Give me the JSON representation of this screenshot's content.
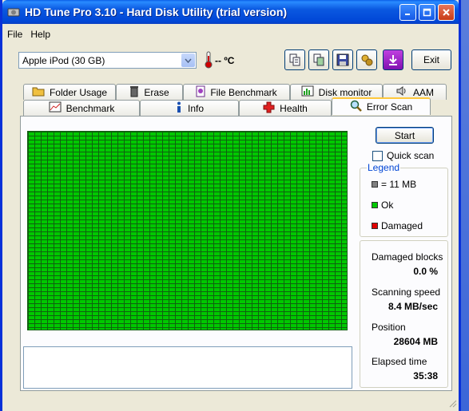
{
  "window": {
    "title": "HD Tune Pro 3.10 - Hard Disk Utility (trial version)"
  },
  "menu": {
    "file": "File",
    "help": "Help"
  },
  "toolbar": {
    "drive": "Apple   iPod (30 GB)",
    "temperature": "-- ºC",
    "exit_label": "Exit",
    "buttons": [
      "copy-text-icon",
      "copy-screen-icon",
      "save-icon",
      "options-icon",
      "download-icon"
    ]
  },
  "tabs": {
    "row1": [
      "Folder Usage",
      "Erase",
      "File Benchmark",
      "Disk monitor",
      "AAM"
    ],
    "row2": [
      "Benchmark",
      "Info",
      "Health",
      "Error Scan"
    ],
    "active": "Error Scan"
  },
  "scan": {
    "start_label": "Start",
    "quick_scan_label": "Quick scan",
    "quick_scan_checked": false,
    "legend_title": "Legend",
    "legend": [
      {
        "label": "= 11 MB",
        "color": "#808080"
      },
      {
        "label": "Ok",
        "color": "#00c800"
      },
      {
        "label": "Damaged",
        "color": "#e00000"
      }
    ],
    "stats": {
      "damaged_blocks_label": "Damaged blocks",
      "damaged_blocks_value": "0.0 %",
      "scanning_speed_label": "Scanning speed",
      "scanning_speed_value": "8.4 MB/sec",
      "position_label": "Position",
      "position_value": "28604 MB",
      "elapsed_label": "Elapsed time",
      "elapsed_value": "35:38"
    },
    "block_color_ok": "#00c800"
  },
  "colors": {
    "titlebar": "#0a58e0",
    "active_tab_accent": "#ffc83c"
  }
}
